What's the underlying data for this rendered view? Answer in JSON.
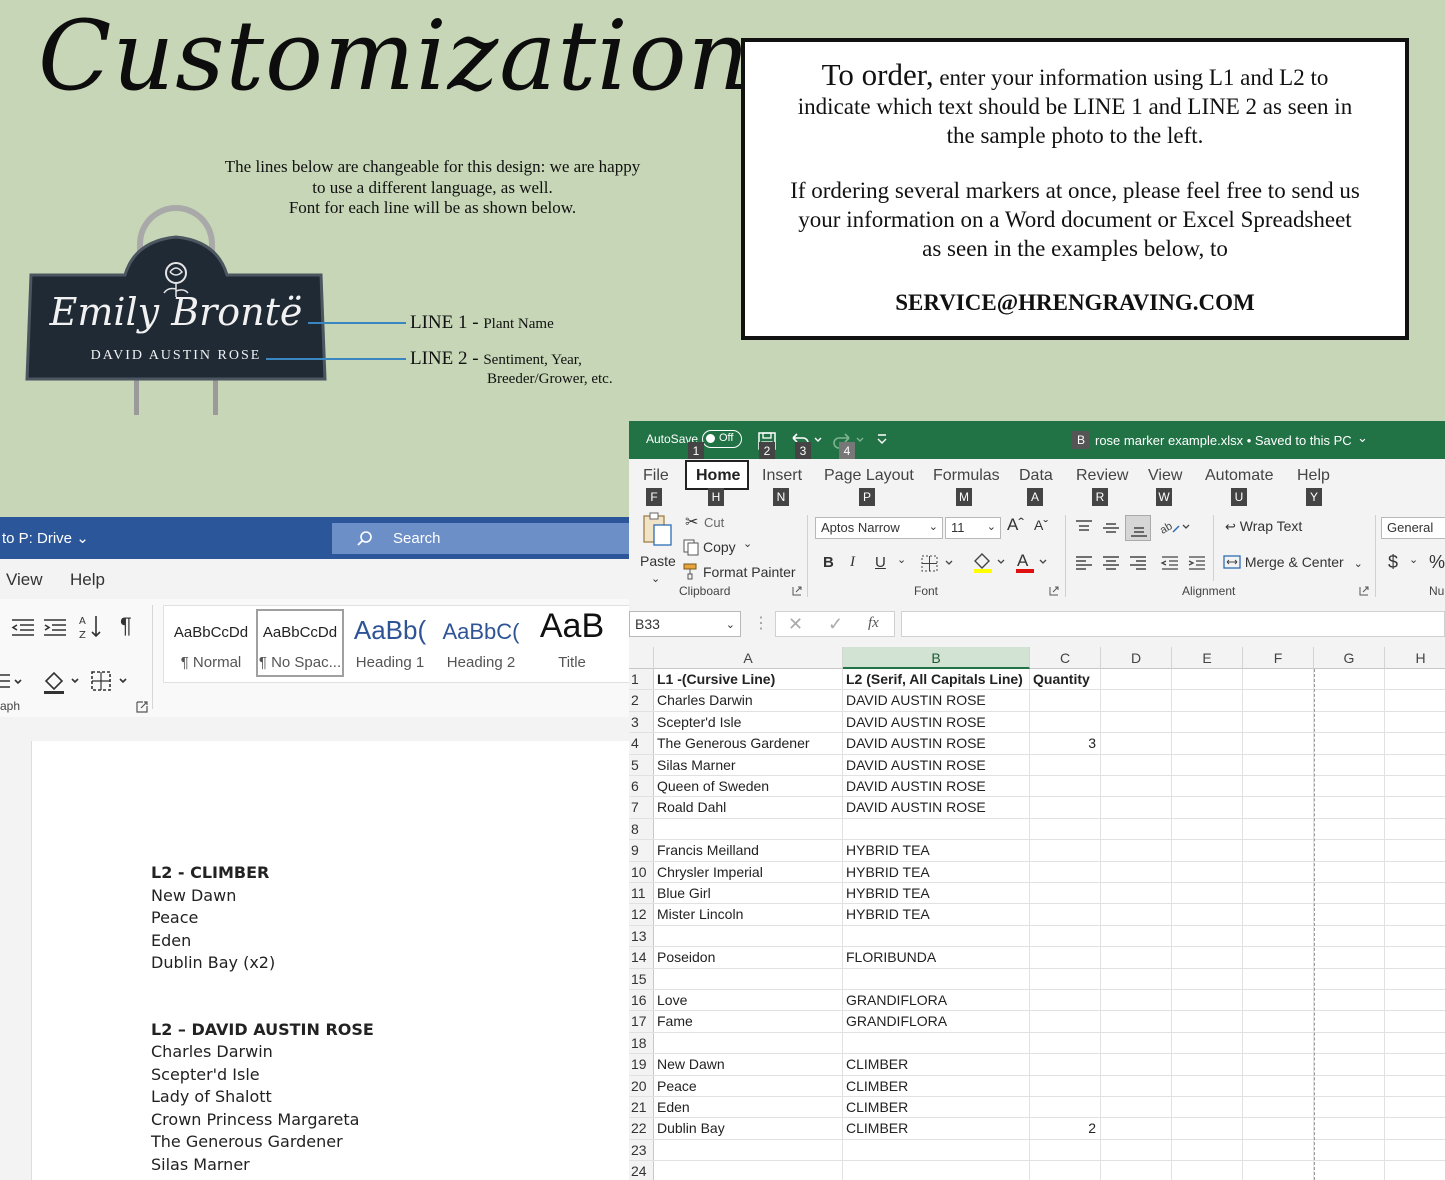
{
  "promo": {
    "title": "Customization",
    "intro_lines": [
      "The lines below are changeable for this design: we are happy",
      "to use a different language, as well.",
      "Font for each line will be as shown below."
    ],
    "sign": {
      "line1": "Emily Brontë",
      "line2": "DAVID AUSTIN ROSE"
    },
    "line1_label": {
      "big": "LINE 1 - ",
      "small": "Plant Name"
    },
    "line2_label": {
      "big": "LINE 2 - ",
      "small_a": "Sentiment, Year,",
      "small_b": "Breeder/Grower, etc."
    },
    "order": {
      "lead": "To order,",
      "p1_rest": " enter your information using L1 and L2 to",
      "p1_l2": "indicate which text should be LINE 1 and LINE 2 as seen in",
      "p1_l3": "the sample photo to the left.",
      "p2_l1": "If ordering several markers at once, please feel free to send us",
      "p2_l2": "your information on a Word document or Excel Spreadsheet",
      "p2_l3": "as seen in the examples below, to",
      "email": "SERVICE@HRENGRAVING.COM"
    }
  },
  "word": {
    "save_location": "to P: Drive",
    "search_placeholder": "Search",
    "menu": [
      "View",
      "Help"
    ],
    "paragraph_group": "aph",
    "styles": [
      {
        "preview": "AaBbCcDd",
        "name": "¶ Normal"
      },
      {
        "preview": "AaBbCcDd",
        "name": "¶ No Spac..."
      },
      {
        "preview": "AaBb(",
        "name": "Heading 1"
      },
      {
        "preview": "AaBbC(",
        "name": "Heading 2"
      },
      {
        "preview": "AaB",
        "name": "Title"
      }
    ],
    "doc": {
      "section1_heading": "L2 - CLIMBER",
      "section1_items": [
        "New Dawn",
        "Peace",
        "Eden",
        "Dublin Bay (x2)"
      ],
      "section2_heading": "L2 – DAVID AUSTIN ROSE",
      "section2_items": [
        "Charles Darwin",
        "Scepter'd Isle",
        "Lady of Shalott",
        "Crown Princess Margareta",
        "The Generous Gardener",
        "Silas Marner"
      ]
    }
  },
  "excel": {
    "autosave_label": "AutoSave",
    "autosave_state": "Off",
    "file_badge": "B",
    "file_title": "rose marker example.xlsx • Saved to this PC",
    "qat_keys": [
      "1",
      "2",
      "3",
      "4"
    ],
    "tabs": [
      {
        "label": "File",
        "key": "F"
      },
      {
        "label": "Home",
        "key": "H"
      },
      {
        "label": "Insert",
        "key": "N"
      },
      {
        "label": "Page Layout",
        "key": "P"
      },
      {
        "label": "Formulas",
        "key": "M"
      },
      {
        "label": "Data",
        "key": "A"
      },
      {
        "label": "Review",
        "key": "R"
      },
      {
        "label": "View",
        "key": "W"
      },
      {
        "label": "Automate",
        "key": "U"
      },
      {
        "label": "Help",
        "key": "Y"
      }
    ],
    "ribbon": {
      "paste": "Paste",
      "cut": "Cut",
      "copy": "Copy",
      "format_painter": "Format Painter",
      "clipboard": "Clipboard",
      "font_name": "Aptos Narrow",
      "font_size": "11",
      "font_group": "Font",
      "wrap_text": "Wrap Text",
      "merge_center": "Merge & Center",
      "alignment_group": "Alignment",
      "number_format": "General",
      "number_group": "Nu",
      "currency": "$",
      "percent": "%"
    },
    "name_box": "B33",
    "fx": "fx",
    "columns": [
      "A",
      "B",
      "C",
      "D",
      "E",
      "F",
      "G",
      "H"
    ],
    "rows": [
      {
        "n": "1",
        "a": "L1 -(Cursive Line)",
        "b": "L2 (Serif, All Capitals Line)",
        "c": "Quantity"
      },
      {
        "n": "2",
        "a": "Charles Darwin",
        "b": "DAVID AUSTIN ROSE",
        "c": ""
      },
      {
        "n": "3",
        "a": "Scepter'd Isle",
        "b": "DAVID AUSTIN ROSE",
        "c": ""
      },
      {
        "n": "4",
        "a": "The Generous Gardener",
        "b": "DAVID AUSTIN ROSE",
        "c": "3"
      },
      {
        "n": "5",
        "a": "Silas Marner",
        "b": "DAVID AUSTIN ROSE",
        "c": ""
      },
      {
        "n": "6",
        "a": "Queen of Sweden",
        "b": "DAVID AUSTIN ROSE",
        "c": ""
      },
      {
        "n": "7",
        "a": "Roald Dahl",
        "b": "DAVID AUSTIN ROSE",
        "c": ""
      },
      {
        "n": "8",
        "a": "",
        "b": "",
        "c": ""
      },
      {
        "n": "9",
        "a": "Francis Meilland",
        "b": "HYBRID TEA",
        "c": ""
      },
      {
        "n": "10",
        "a": "Chrysler Imperial",
        "b": "HYBRID TEA",
        "c": ""
      },
      {
        "n": "11",
        "a": "Blue Girl",
        "b": "HYBRID TEA",
        "c": ""
      },
      {
        "n": "12",
        "a": "Mister Lincoln",
        "b": "HYBRID TEA",
        "c": ""
      },
      {
        "n": "13",
        "a": "",
        "b": "",
        "c": ""
      },
      {
        "n": "14",
        "a": "Poseidon",
        "b": "FLORIBUNDA",
        "c": ""
      },
      {
        "n": "15",
        "a": "",
        "b": "",
        "c": ""
      },
      {
        "n": "16",
        "a": "Love",
        "b": "GRANDIFLORA",
        "c": ""
      },
      {
        "n": "17",
        "a": "Fame",
        "b": "GRANDIFLORA",
        "c": ""
      },
      {
        "n": "18",
        "a": "",
        "b": "",
        "c": ""
      },
      {
        "n": "19",
        "a": "New Dawn",
        "b": "CLIMBER",
        "c": ""
      },
      {
        "n": "20",
        "a": "Peace",
        "b": "CLIMBER",
        "c": ""
      },
      {
        "n": "21",
        "a": "Eden",
        "b": "CLIMBER",
        "c": ""
      },
      {
        "n": "22",
        "a": "Dublin Bay",
        "b": "CLIMBER",
        "c": "2"
      },
      {
        "n": "23",
        "a": "",
        "b": "",
        "c": ""
      },
      {
        "n": "24",
        "a": "",
        "b": "",
        "c": ""
      }
    ]
  }
}
